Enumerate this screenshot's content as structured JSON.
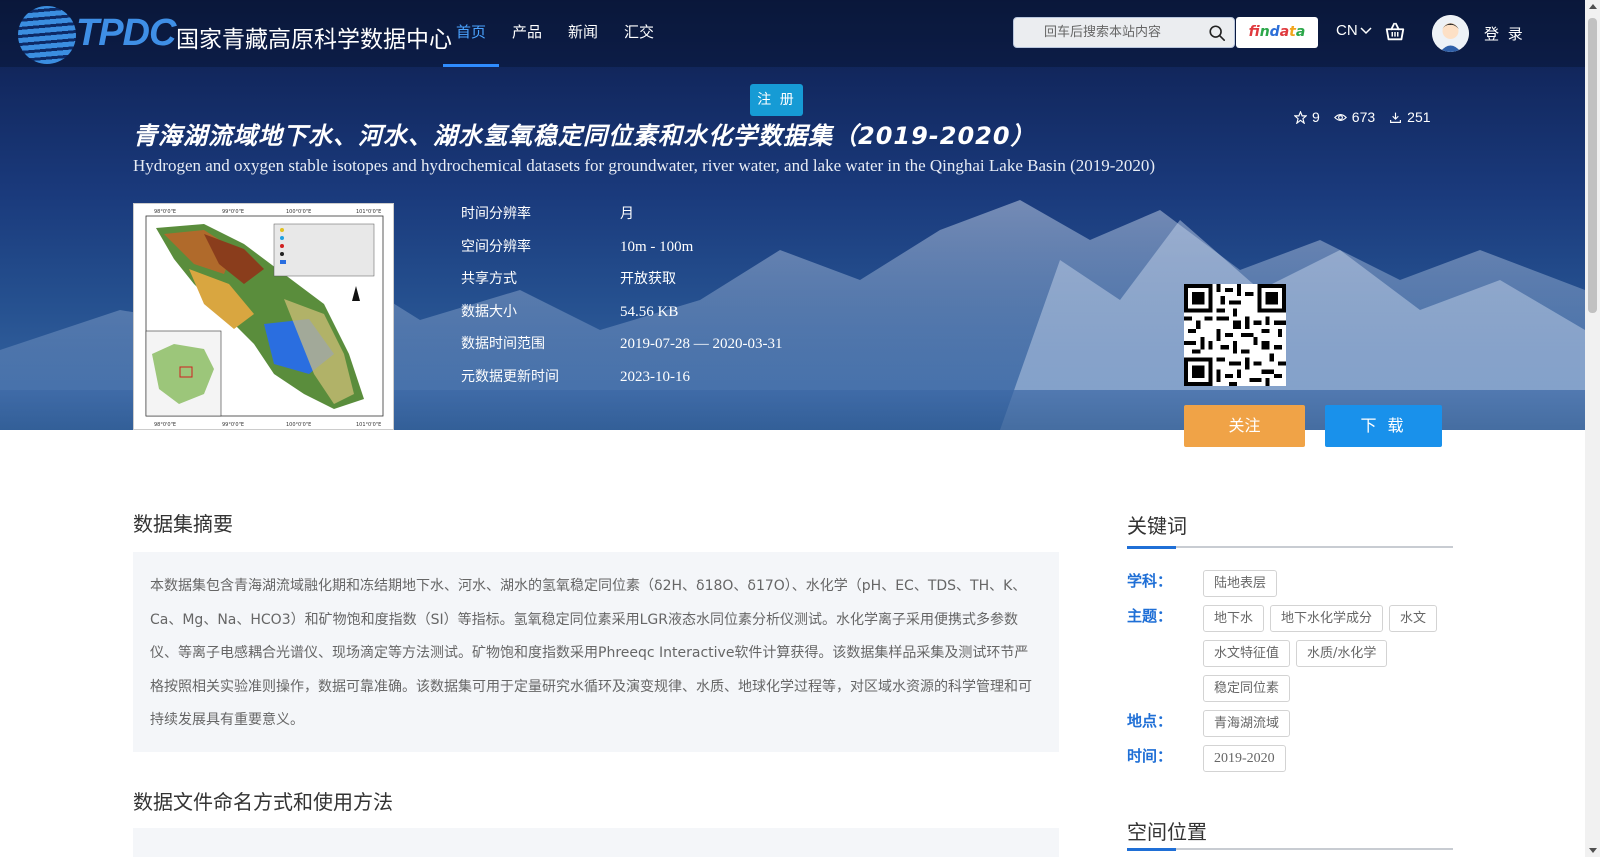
{
  "header": {
    "logo_mark": "TPDC",
    "logo_text": "国家青藏高原科学数据中心",
    "nav": [
      {
        "label": "首页",
        "active": true
      },
      {
        "label": "产品",
        "active": false
      },
      {
        "label": "新闻",
        "active": false
      },
      {
        "label": "汇交",
        "active": false
      }
    ],
    "search_placeholder": "回车后搜索本站内容",
    "findata_label": "findata",
    "lang_label": "CN",
    "login_label": "登 录"
  },
  "register_label": "注 册",
  "dataset": {
    "title_cn": "青海湖流域地下水、河水、湖水氢氧稳定同位素和水化学数据集（2019-2020）",
    "title_en": "Hydrogen and oxygen stable isotopes and hydrochemical datasets for groundwater, river water, and lake water in the Qinghai Lake Basin (2019-2020)",
    "stats": {
      "stars": "9",
      "views": "673",
      "downloads": "251"
    },
    "meta": [
      {
        "label": "时间分辨率",
        "value": "月"
      },
      {
        "label": "空间分辨率",
        "value": "10m - 100m"
      },
      {
        "label": "共享方式",
        "value": "开放获取"
      },
      {
        "label": "数据大小",
        "value": "54.56 KB"
      },
      {
        "label": "数据时间范围",
        "value": "2019-07-28 — 2020-03-31"
      },
      {
        "label": "元数据更新时间",
        "value": "2023-10-16"
      }
    ],
    "follow_label": "关注",
    "download_label": "下 载"
  },
  "abstract": {
    "heading": "数据集摘要",
    "text": "本数据集包含青海湖流域融化期和冻结期地下水、河水、湖水的氢氧稳定同位素（δ2H、δ18O、δ17O）、水化学（pH、EC、TDS、TH、K、Ca、Mg、Na、HCO3）和矿物饱和度指数（SI）等指标。氢氧稳定同位素采用LGR液态水同位素分析仪测试。水化学离子采用便携式多参数仪、等离子电感耦合光谱仪、现场滴定等方法测试。矿物饱和度指数采用Phreeqc Interactive软件计算获得。该数据集样品采集及测试环节严格按照相关实验准则操作，数据可靠准确。该数据集可用于定量研究水循环及演变规律、水质、地球化学过程等，对区域水资源的科学管理和可持续发展具有重要意义。"
  },
  "naming_heading": "数据文件命名方式和使用方法",
  "keywords": {
    "heading": "关键词",
    "groups": [
      {
        "label": "学科：",
        "tags": [
          "陆地表层"
        ]
      },
      {
        "label": "主题：",
        "tags": [
          "地下水",
          "地下水化学成分",
          "水文",
          "水文特征值",
          "水质/水化学",
          "稳定同位素"
        ]
      },
      {
        "label": "地点：",
        "tags": [
          "青海湖流域"
        ]
      },
      {
        "label": "时间：",
        "tags": [
          "2019-2020"
        ]
      }
    ]
  },
  "spatial_heading": "空间位置"
}
